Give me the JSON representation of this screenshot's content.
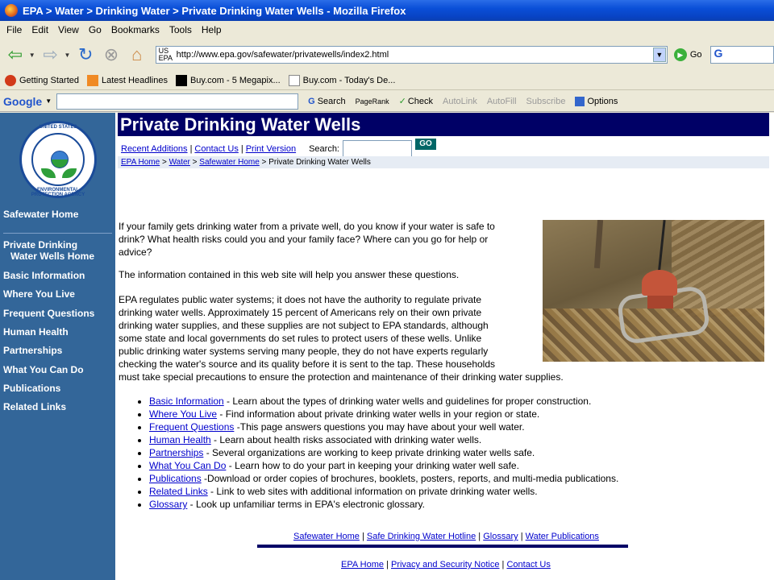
{
  "window": {
    "title": "EPA > Water > Drinking Water > Private Drinking Water Wells - Mozilla Firefox"
  },
  "menu": [
    "File",
    "Edit",
    "View",
    "Go",
    "Bookmarks",
    "Tools",
    "Help"
  ],
  "nav": {
    "url_prefix": "US EPA",
    "url": "http://www.epa.gov/safewater/privatewells/index2.html",
    "go_label": "Go"
  },
  "bookmarks": [
    {
      "label": "Getting Started",
      "icon": "firefox-icon"
    },
    {
      "label": "Latest Headlines",
      "icon": "rss-icon"
    },
    {
      "label": "Buy.com - 5 Megapix...",
      "icon": "buy-icon"
    },
    {
      "label": "Buy.com - Today's De...",
      "icon": "page-icon"
    }
  ],
  "googlebar": {
    "logo": "Google",
    "search": "Search",
    "pagerank": "PageRank",
    "check": "Check",
    "autolink": "AutoLink",
    "autofill": "AutoFill",
    "subscribe": "Subscribe",
    "options": "Options"
  },
  "sidebar": {
    "safewater_home": "Safewater Home",
    "pdw_home_1": "Private Drinking",
    "pdw_home_2": "Water Wells Home",
    "items": [
      "Basic Information",
      "Where You Live",
      "Frequent Questions",
      "Human Health",
      "Partnerships",
      "What You Can Do",
      "Publications",
      "Related Links"
    ],
    "seal_top": "UNITED STATES",
    "seal_bottom": "ENVIRONMENTAL PROTECTION AGENCY"
  },
  "page": {
    "title": "Private Drinking Water Wells",
    "top_links": [
      "Recent Additions",
      "Contact Us",
      "Print Version"
    ],
    "search_label": "Search:",
    "go_button": "GO",
    "breadcrumb": {
      "links": [
        "EPA Home",
        "Water",
        "Safewater Home"
      ],
      "current": "Private Drinking Water Wells"
    },
    "para1_l1": "If your family gets drinking water from a private well, do you know if your water is safe to",
    "para1_l2": "drink? What health risks could you and your family face? Where can you go for help or",
    "para1_l3": "advice?",
    "para2": "The information contained in this web site will help you answer these questions.",
    "para3_lines": [
      "EPA regulates public water systems; it does not have the authority to regulate private",
      "drinking water wells. Approximately 15 percent of Americans rely on their own private",
      "drinking water supplies, and these supplies are not subject to EPA standards, although",
      "some state and local governments do set rules to protect users of these wells. Unlike",
      "public drinking water systems serving many people, they do not have experts regularly",
      "checking the water's source and its quality before it is sent to the tap. These households",
      "must take special precautions to ensure the protection and maintenance of their drinking water supplies."
    ],
    "bullets": [
      {
        "link": "Basic Information",
        "text": " - Learn about the types of drinking water wells and guidelines for proper construction."
      },
      {
        "link": "Where You Live",
        "text": " - Find information about private drinking water wells in your region or state."
      },
      {
        "link": "Frequent Questions",
        "text": " -This page answers questions you may have about your well water."
      },
      {
        "link": "Human Health",
        "text": " - Learn about health risks associated with drinking water wells."
      },
      {
        "link": "Partnerships",
        "text": " - Several organizations are working to keep private drinking water wells safe."
      },
      {
        "link": "What You Can Do",
        "text": " - Learn how to do your part in keeping your drinking water well safe."
      },
      {
        "link": "Publications",
        "text": " -Download or order copies of brochures, booklets, posters, reports, and multi-media publications."
      },
      {
        "link": "Related Links",
        "text": " - Link to web sites with additional information on private drinking water wells."
      },
      {
        "link": "Glossary",
        "text": " - Look up unfamiliar terms in EPA's electronic glossary."
      }
    ],
    "footer1": [
      "Safewater Home",
      "Safe Drinking Water Hotline",
      "Glossary",
      "Water Publications"
    ],
    "footer2": [
      "EPA Home",
      "Privacy and Security Notice",
      "Contact Us"
    ]
  }
}
